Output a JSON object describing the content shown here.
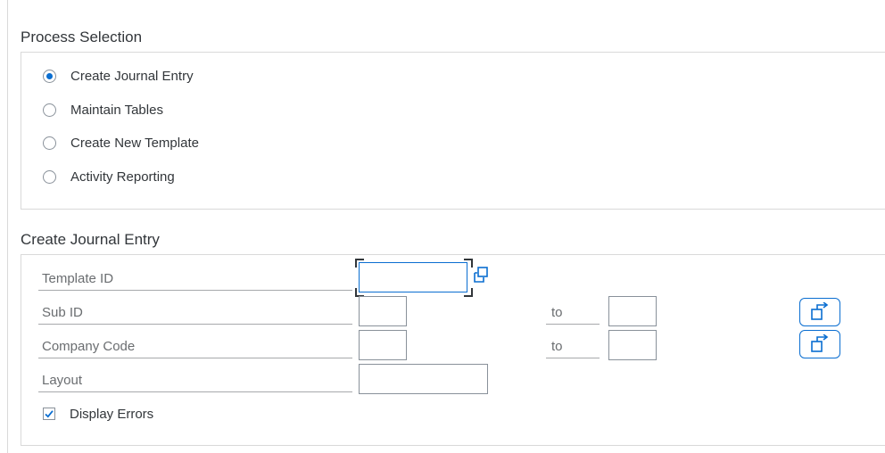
{
  "process_selection": {
    "title": "Process Selection",
    "options": [
      {
        "label": "Create Journal Entry",
        "selected": true
      },
      {
        "label": "Maintain Tables",
        "selected": false
      },
      {
        "label": "Create New Template",
        "selected": false
      },
      {
        "label": "Activity Reporting",
        "selected": false
      }
    ]
  },
  "journal_entry": {
    "title": "Create Journal Entry",
    "template_id": {
      "label": "Template ID",
      "value": ""
    },
    "sub_id": {
      "label": "Sub ID",
      "from": "",
      "to_label": "to",
      "to": ""
    },
    "company_code": {
      "label": "Company Code",
      "from": "",
      "to_label": "to",
      "to": ""
    },
    "layout": {
      "label": "Layout",
      "value": ""
    },
    "display_errors": {
      "label": "Display Errors",
      "checked": true
    }
  },
  "colors": {
    "accent": "#0a6ed1",
    "text": "#32363a",
    "label": "#6a6d70",
    "border": "#d9d9d9"
  },
  "icons": {
    "value_help": "value-help-icon",
    "multiple_selection": "multiple-selection-icon",
    "checkmark": "checkmark-icon"
  }
}
